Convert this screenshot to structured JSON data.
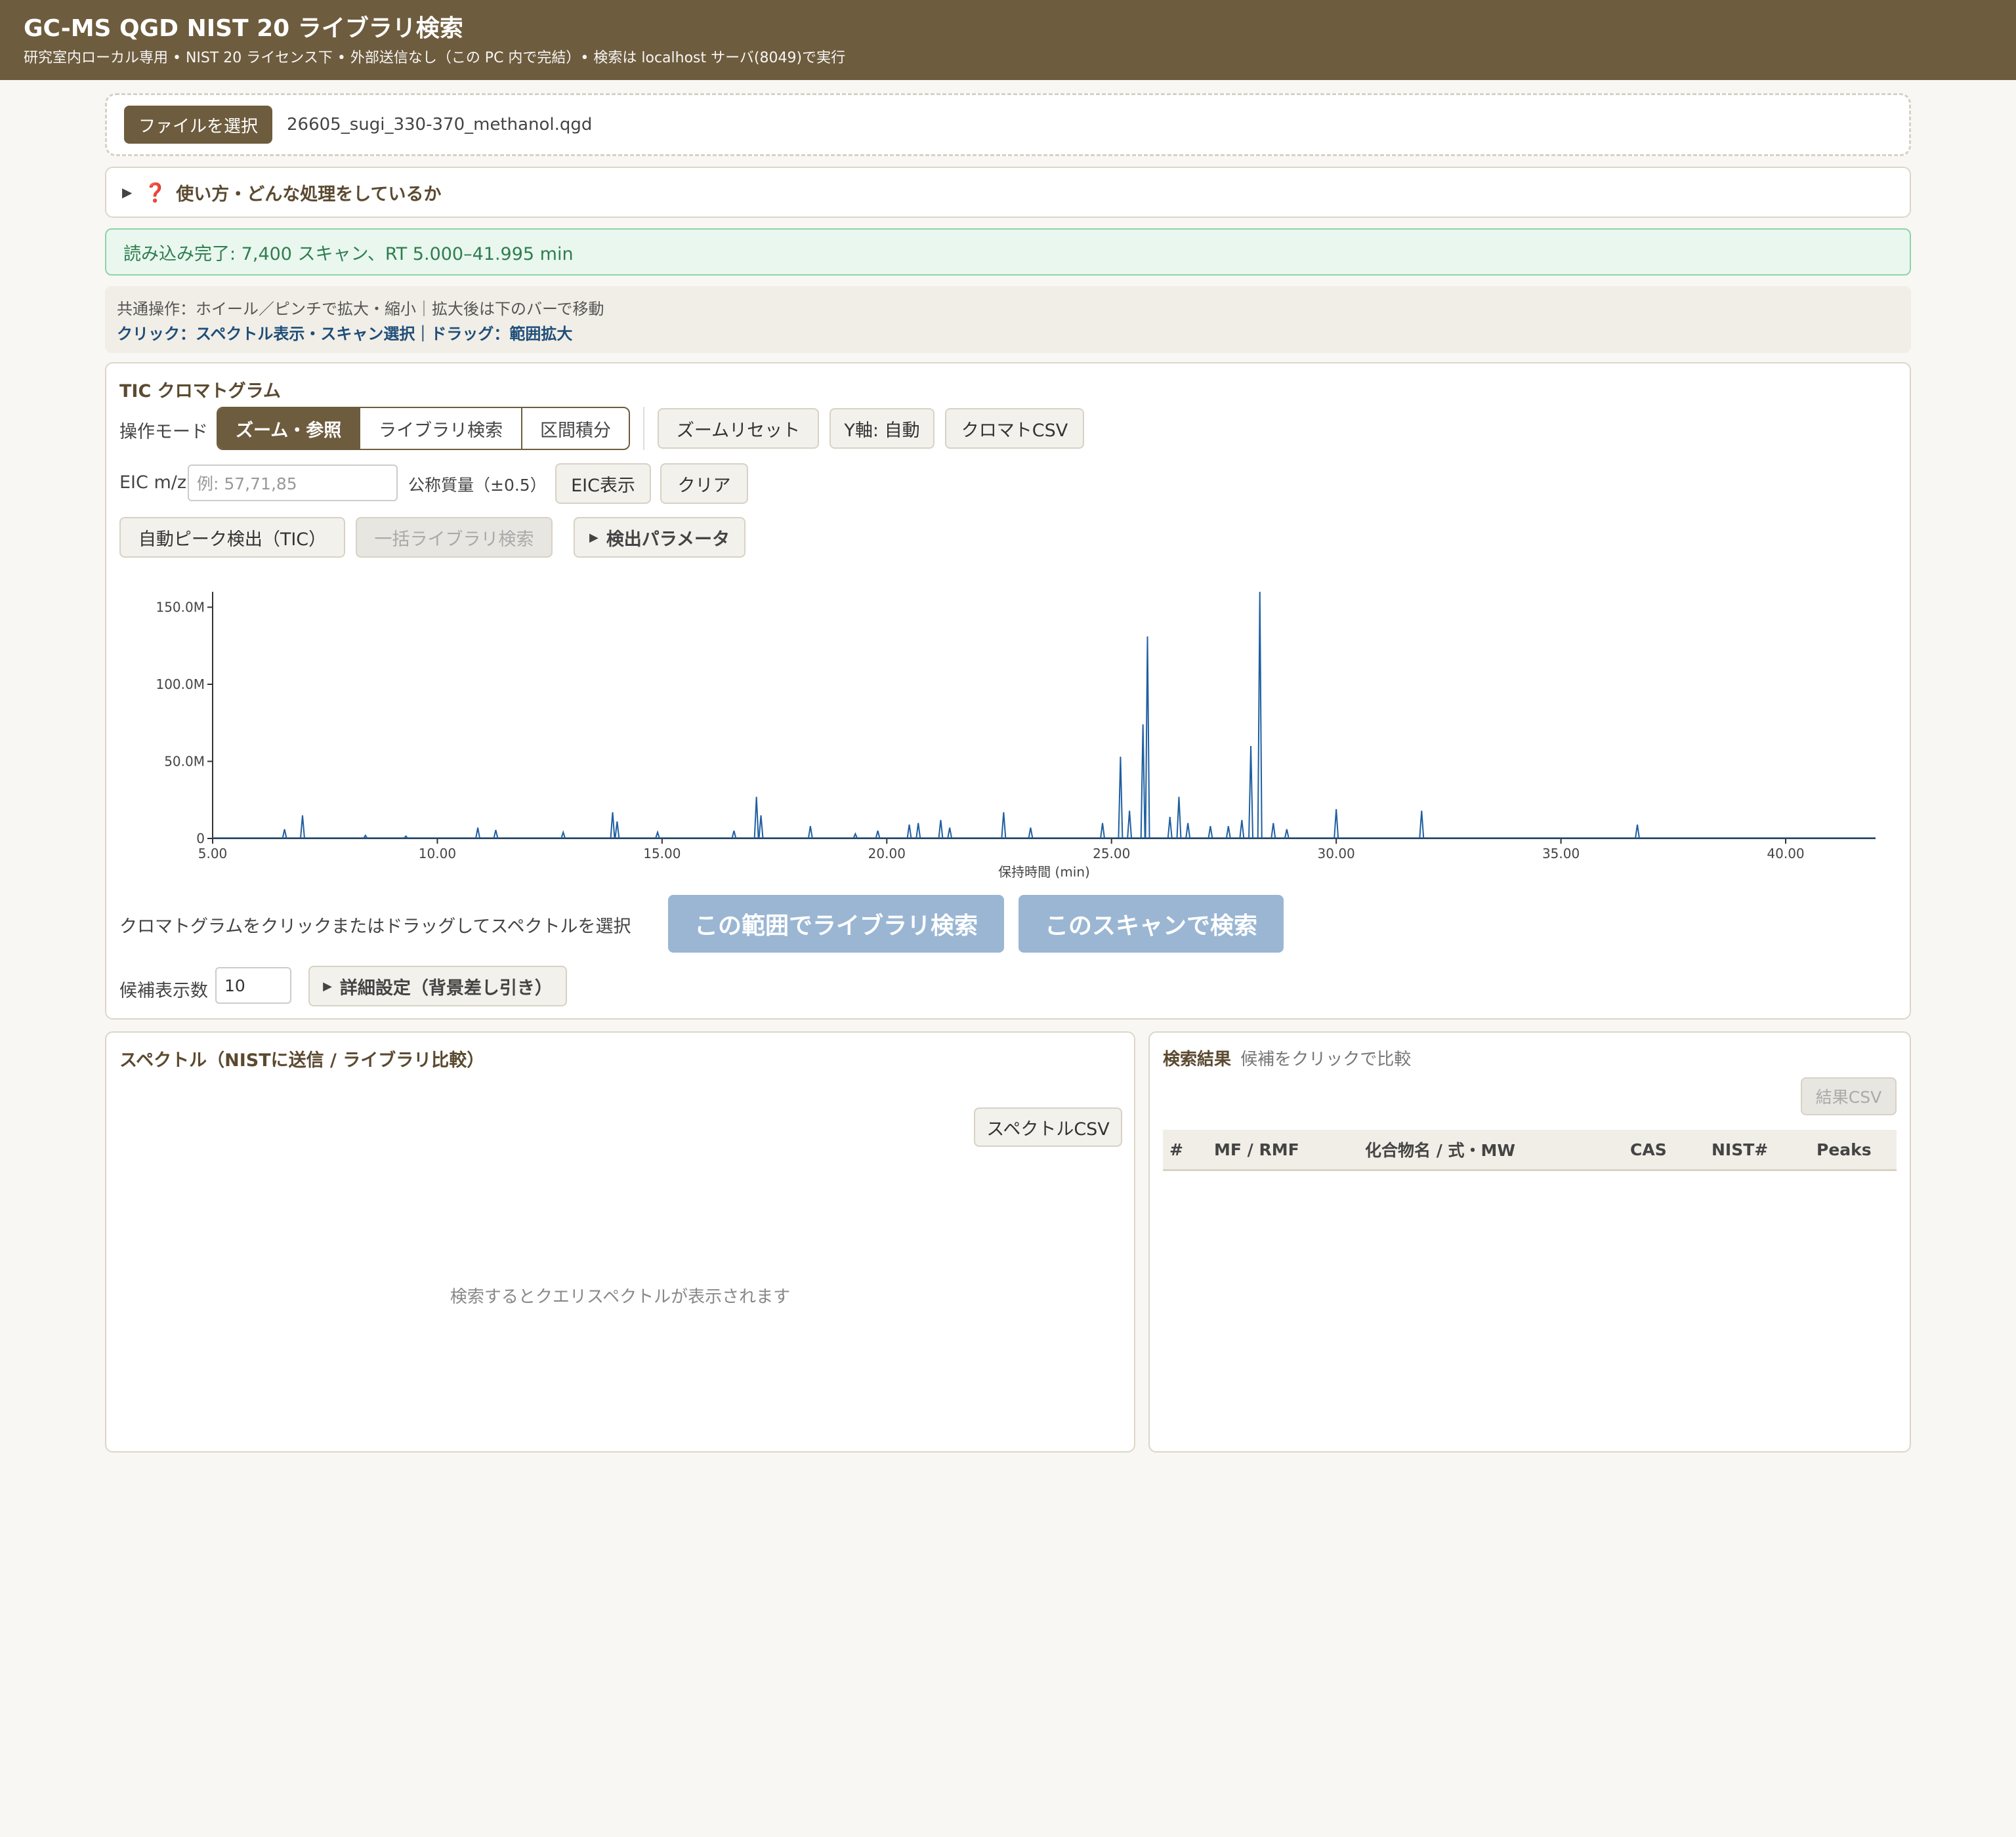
{
  "header": {
    "title": "GC-MS QGD NIST 20 ライブラリ検索",
    "subtitle": "研究室内ローカル専用 • NIST 20 ライセンス下 • 外部送信なし（この PC 内で完結）• 検索は localhost サーバ(8049)で実行"
  },
  "file": {
    "button_label": "ファイルを選択",
    "filename": "26605_sugi_330-370_methanol.qgd"
  },
  "help": {
    "label": "使い方・どんな処理をしているか"
  },
  "status": {
    "text": "読み込み完了: 7,400 スキャン、RT 5.000–41.995 min"
  },
  "ops": {
    "line1": "共通操作：ホイール／ピンチで拡大・縮小｜拡大後は下のバーで移動",
    "line2": "クリック：スペクトル表示・スキャン選択｜ドラッグ：範囲拡大"
  },
  "tic": {
    "title": "TIC クロマトグラム",
    "mode_label": "操作モード",
    "modes": [
      "ズーム・参照",
      "ライブラリ検索",
      "区間積分"
    ],
    "active_mode": "ズーム・参照",
    "zoom_reset": "ズームリセット",
    "y_axis": "Y軸: 自動",
    "chromat_csv": "クロマトCSV",
    "eic_label": "EIC m/z",
    "eic_placeholder": "例: 57,71,85",
    "nominal_mass": "公称質量（±0.5）",
    "eic_show": "EIC表示",
    "clear": "クリア",
    "auto_peak": "自動ピーク検出（TIC）",
    "batch_search": "一括ライブラリ検索",
    "detect_params": "検出パラメータ",
    "select_hint": "クロマトグラムをクリックまたはドラッグしてスペクトルを選択",
    "search_range": "この範囲でライブラリ検索",
    "search_scan": "このスキャンで検索",
    "candidates_label": "候補表示数",
    "candidates_value": "10",
    "advanced": "詳細設定（背景差し引き）"
  },
  "chart_data": {
    "type": "line",
    "xlabel": "保持時間 (min)",
    "ylabel": "",
    "xlim": [
      5.0,
      42.0
    ],
    "ylim": [
      0,
      160000000
    ],
    "x_ticks": [
      "5.00",
      "10.00",
      "15.00",
      "20.00",
      "25.00",
      "30.00",
      "35.00",
      "40.00"
    ],
    "y_ticks": [
      "0",
      "50.0M",
      "100.0M",
      "150.0M"
    ],
    "color": "#1f5fa0",
    "peaks": [
      {
        "x": 6.6,
        "y": 6000000
      },
      {
        "x": 7.0,
        "y": 15000000
      },
      {
        "x": 8.4,
        "y": 2000000
      },
      {
        "x": 9.3,
        "y": 1500000
      },
      {
        "x": 10.9,
        "y": 7000000
      },
      {
        "x": 11.3,
        "y": 5500000
      },
      {
        "x": 12.8,
        "y": 4000000
      },
      {
        "x": 13.9,
        "y": 17000000
      },
      {
        "x": 14.0,
        "y": 11000000
      },
      {
        "x": 14.9,
        "y": 4000000
      },
      {
        "x": 16.6,
        "y": 5000000
      },
      {
        "x": 17.1,
        "y": 27000000
      },
      {
        "x": 17.2,
        "y": 15000000
      },
      {
        "x": 18.3,
        "y": 8000000
      },
      {
        "x": 19.3,
        "y": 3000000
      },
      {
        "x": 19.8,
        "y": 5000000
      },
      {
        "x": 20.5,
        "y": 9000000
      },
      {
        "x": 20.7,
        "y": 10000000
      },
      {
        "x": 21.2,
        "y": 12000000
      },
      {
        "x": 21.4,
        "y": 7000000
      },
      {
        "x": 22.6,
        "y": 17000000
      },
      {
        "x": 23.2,
        "y": 7000000
      },
      {
        "x": 24.8,
        "y": 10000000
      },
      {
        "x": 25.2,
        "y": 53000000
      },
      {
        "x": 25.4,
        "y": 18000000
      },
      {
        "x": 25.7,
        "y": 74000000
      },
      {
        "x": 25.8,
        "y": 131000000
      },
      {
        "x": 26.3,
        "y": 14000000
      },
      {
        "x": 26.5,
        "y": 27000000
      },
      {
        "x": 26.7,
        "y": 10000000
      },
      {
        "x": 27.2,
        "y": 8000000
      },
      {
        "x": 27.6,
        "y": 8000000
      },
      {
        "x": 27.9,
        "y": 12000000
      },
      {
        "x": 28.1,
        "y": 60000000
      },
      {
        "x": 28.3,
        "y": 160000000
      },
      {
        "x": 28.6,
        "y": 10000000
      },
      {
        "x": 28.9,
        "y": 6000000
      },
      {
        "x": 30.0,
        "y": 19000000
      },
      {
        "x": 31.9,
        "y": 18000000
      },
      {
        "x": 36.7,
        "y": 9000000
      }
    ]
  },
  "spectrum": {
    "title": "スペクトル（NISTに送信 / ライブラリ比較）",
    "csv_button": "スペクトルCSV",
    "placeholder": "検索するとクエリスペクトルが表示されます"
  },
  "results": {
    "title": "検索結果",
    "hint": "候補をクリックで比較",
    "csv_button": "結果CSV",
    "columns": [
      "#",
      "MF / RMF",
      "化合物名 / 式・MW",
      "CAS",
      "NIST#",
      "Peaks"
    ]
  }
}
